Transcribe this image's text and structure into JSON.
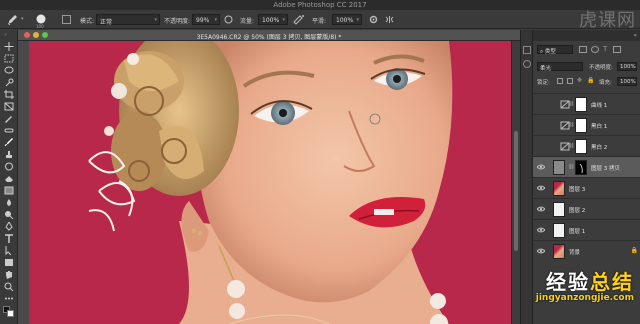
{
  "app": {
    "title": "Adobe Photoshop CC 2017"
  },
  "options_bar": {
    "brush_size": "100",
    "mode_label": "模式:",
    "mode_value": "正常",
    "opacity_label": "不透明度:",
    "opacity_value": "99%",
    "flow_label": "流量:",
    "flow_value": "100%",
    "smoothing_label": "平滑:",
    "smoothing_value": "100%"
  },
  "document": {
    "title": "3E5A0946.CR2 @ 50% (图层 3 拷贝, 图层蒙版/8) *"
  },
  "layers_panel": {
    "filter_label": "类型",
    "blend_mode": "柔光",
    "opacity_label": "不透明度:",
    "opacity_value": "100%",
    "lock_label": "锁定:",
    "fill_label": "填充:",
    "fill_value": "100%",
    "layers": [
      {
        "name": "曲线 1",
        "visible": false,
        "type": "adjustment"
      },
      {
        "name": "黑白 1",
        "visible": false,
        "type": "adjustment"
      },
      {
        "name": "黑白 2",
        "visible": false,
        "type": "adjustment"
      },
      {
        "name": "图层 3 拷贝",
        "visible": true,
        "type": "masked",
        "selected": true
      },
      {
        "name": "图层 3",
        "visible": true,
        "type": "photo"
      },
      {
        "name": "图层 2",
        "visible": true,
        "type": "plain"
      },
      {
        "name": "图层 1",
        "visible": true,
        "type": "plain"
      },
      {
        "name": "背景",
        "visible": true,
        "type": "background"
      }
    ]
  },
  "watermark": {
    "top": "虎课网",
    "bottom_cn_1": "经验",
    "bottom_cn_2": "总结",
    "bottom_url": "jingyanzongjie.com"
  },
  "colors": {
    "canvas_background": "#b8284a",
    "panel_dark": "#3c3c3c",
    "close_dot": "#ec5f57",
    "minimize_dot": "#e1b23a",
    "zoom_dot": "#5fc24a"
  }
}
